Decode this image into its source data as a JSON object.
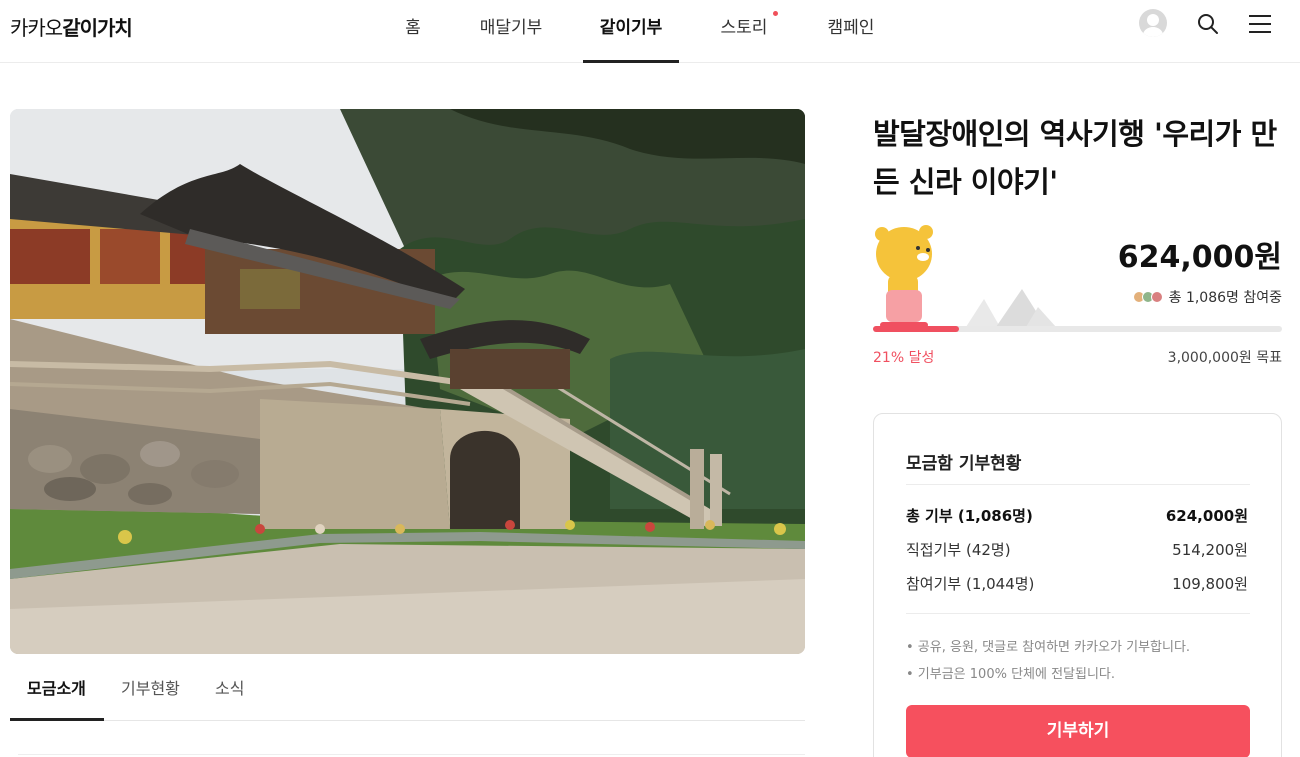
{
  "header": {
    "logo_prefix": "카카오",
    "logo_strong": "같이가치",
    "nav": [
      "홈",
      "매달기부",
      "같이기부",
      "스토리",
      "캠페인"
    ],
    "active_nav": "같이기부"
  },
  "colors": {
    "accent": "#f6505e",
    "progress": "#f05060",
    "text": "#222222"
  },
  "icons": [
    "avatar-icon",
    "search-icon",
    "menu-icon"
  ],
  "campaign": {
    "title": "발달장애인의 역사기행 '우리가 만든 신라 이야기'",
    "amount": "624,000원",
    "participants_prefix": "총 1,086명 참여중",
    "progress_ratio": 0.21,
    "achieved": "21% 달성",
    "goal": "3,000,000원 목표"
  },
  "tabs": [
    "모금소개",
    "기부현황",
    "소식"
  ],
  "card": {
    "title": "모금함 기부현황",
    "rows": [
      {
        "label": "총 기부 (1,086명)",
        "value": "624,000원"
      },
      {
        "label": "직접기부 (42명)",
        "value": "514,200원"
      },
      {
        "label": "참여기부 (1,044명)",
        "value": "109,800원"
      }
    ],
    "notes": [
      "• 공유, 응원, 댓글로 참여하면 카카오가 기부합니다.",
      "• 기부금은 100% 단체에 전달됩니다."
    ],
    "button": "기부하기"
  }
}
